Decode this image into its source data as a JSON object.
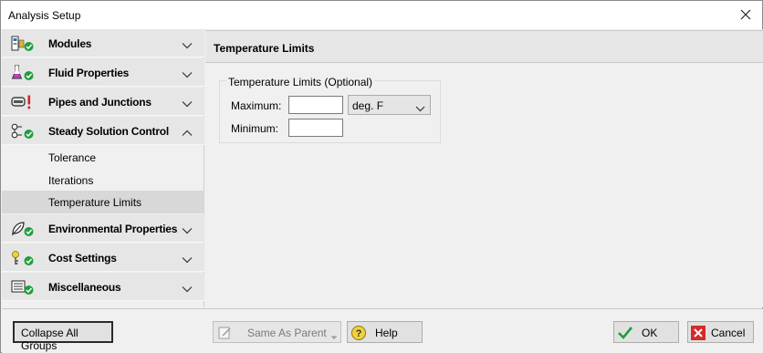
{
  "window": {
    "title": "Analysis Setup",
    "close_icon": "close-icon"
  },
  "sidebar": {
    "groups": [
      {
        "label": "Modules",
        "icon": "modules-icon",
        "status": "ok",
        "expanded": false
      },
      {
        "label": "Fluid Properties",
        "icon": "flask-icon",
        "status": "ok",
        "expanded": false
      },
      {
        "label": "Pipes and Junctions",
        "icon": "pipe-icon",
        "status": "error",
        "expanded": false
      },
      {
        "label": "Steady Solution Control",
        "icon": "solution-control-icon",
        "status": "ok",
        "expanded": true,
        "items": [
          {
            "label": "Tolerance"
          },
          {
            "label": "Iterations"
          },
          {
            "label": "Temperature Limits",
            "selected": true
          }
        ]
      },
      {
        "label": "Environmental Properties",
        "icon": "leaf-icon",
        "status": "ok",
        "expanded": false
      },
      {
        "label": "Cost Settings",
        "icon": "cost-icon",
        "status": "ok",
        "expanded": false
      },
      {
        "label": "Miscellaneous",
        "icon": "list-icon",
        "status": "ok",
        "expanded": false
      }
    ]
  },
  "panel": {
    "header": "Temperature Limits",
    "group_label": "Temperature Limits (Optional)",
    "maximum_label": "Maximum:",
    "maximum_value": "",
    "minimum_label": "Minimum:",
    "minimum_value": "",
    "unit_selected": "deg. F"
  },
  "footer": {
    "collapse_label": "Collapse All Groups",
    "same_as_parent_label": "Same As Parent",
    "help_label": "Help",
    "ok_label": "OK",
    "cancel_label": "Cancel"
  },
  "colors": {
    "ok_green": "#1e9e3e",
    "error_red": "#d9212c",
    "cancel_red": "#d42a2a"
  }
}
